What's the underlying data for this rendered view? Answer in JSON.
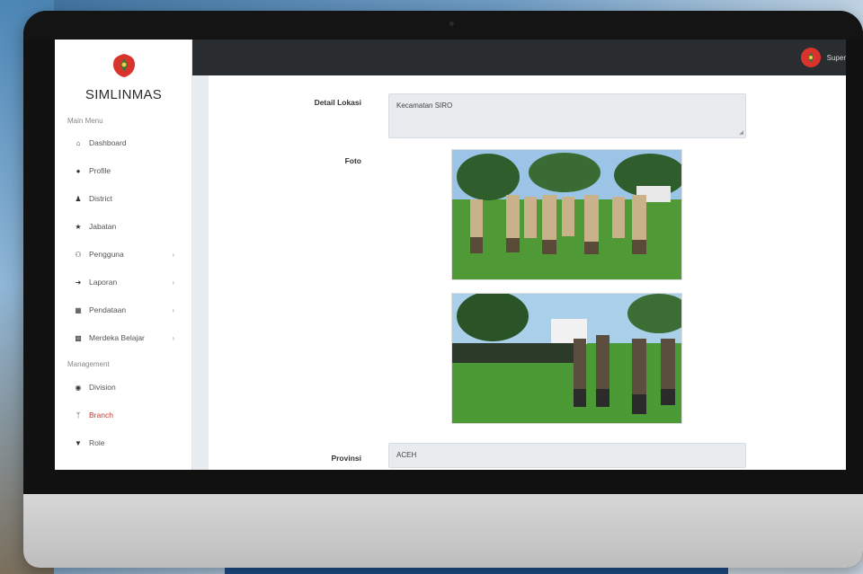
{
  "app": {
    "brand": "SIMLINMAS"
  },
  "sidebar": {
    "main_menu_label": "Main Menu",
    "management_label": "Management",
    "items": [
      {
        "label": "Dashboard",
        "icon": "home-icon"
      },
      {
        "label": "Profile",
        "icon": "user-icon"
      },
      {
        "label": "District",
        "icon": "person-icon"
      },
      {
        "label": "Jabatan",
        "icon": "star-icon"
      },
      {
        "label": "Pengguna",
        "icon": "users-icon",
        "has_submenu": true
      },
      {
        "label": "Laporan",
        "icon": "arrow-icon",
        "has_submenu": true
      },
      {
        "label": "Pendataan",
        "icon": "clipboard-icon",
        "has_submenu": true
      },
      {
        "label": "Merdeka Belajar",
        "icon": "chart-icon",
        "has_submenu": true
      }
    ],
    "management_items": [
      {
        "label": "Division",
        "icon": "globe-icon"
      },
      {
        "label": "Branch",
        "icon": "branch-icon"
      },
      {
        "label": "Role",
        "icon": "shield-icon"
      }
    ]
  },
  "topbar": {
    "user_name": "Super"
  },
  "form": {
    "detail_lokasi_label": "Detail Lokasi",
    "detail_lokasi_value": "Kecamatan SIRO",
    "foto_label": "Foto",
    "provinsi_label": "Provinsi",
    "provinsi_value": "ACEH"
  },
  "colors": {
    "topbar": "#2a2d30",
    "logo_red": "#d9342b",
    "field_bg": "#e8ecef"
  }
}
